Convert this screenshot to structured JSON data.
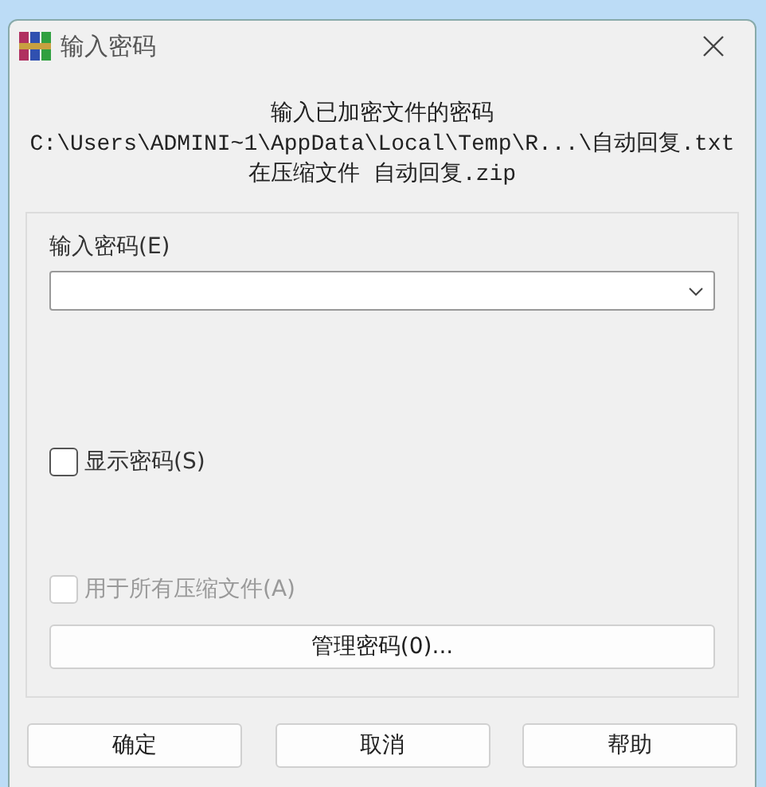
{
  "window": {
    "title": "输入密码"
  },
  "header": {
    "lines": [
      "输入已加密文件的密码",
      "C:\\Users\\ADMINI~1\\AppData\\Local\\Temp\\R...\\自动回复.txt",
      "在压缩文件 自动回复.zip"
    ]
  },
  "password": {
    "label": "输入密码(E)"
  },
  "checkboxes": [
    {
      "label": "显示密码(S)",
      "checked": false,
      "disabled": false
    },
    {
      "label": "用于所有压缩文件(A)",
      "checked": false,
      "disabled": true
    }
  ],
  "manage_button": "管理密码(0)...",
  "buttons": [
    "确定",
    "取消",
    "帮助"
  ]
}
